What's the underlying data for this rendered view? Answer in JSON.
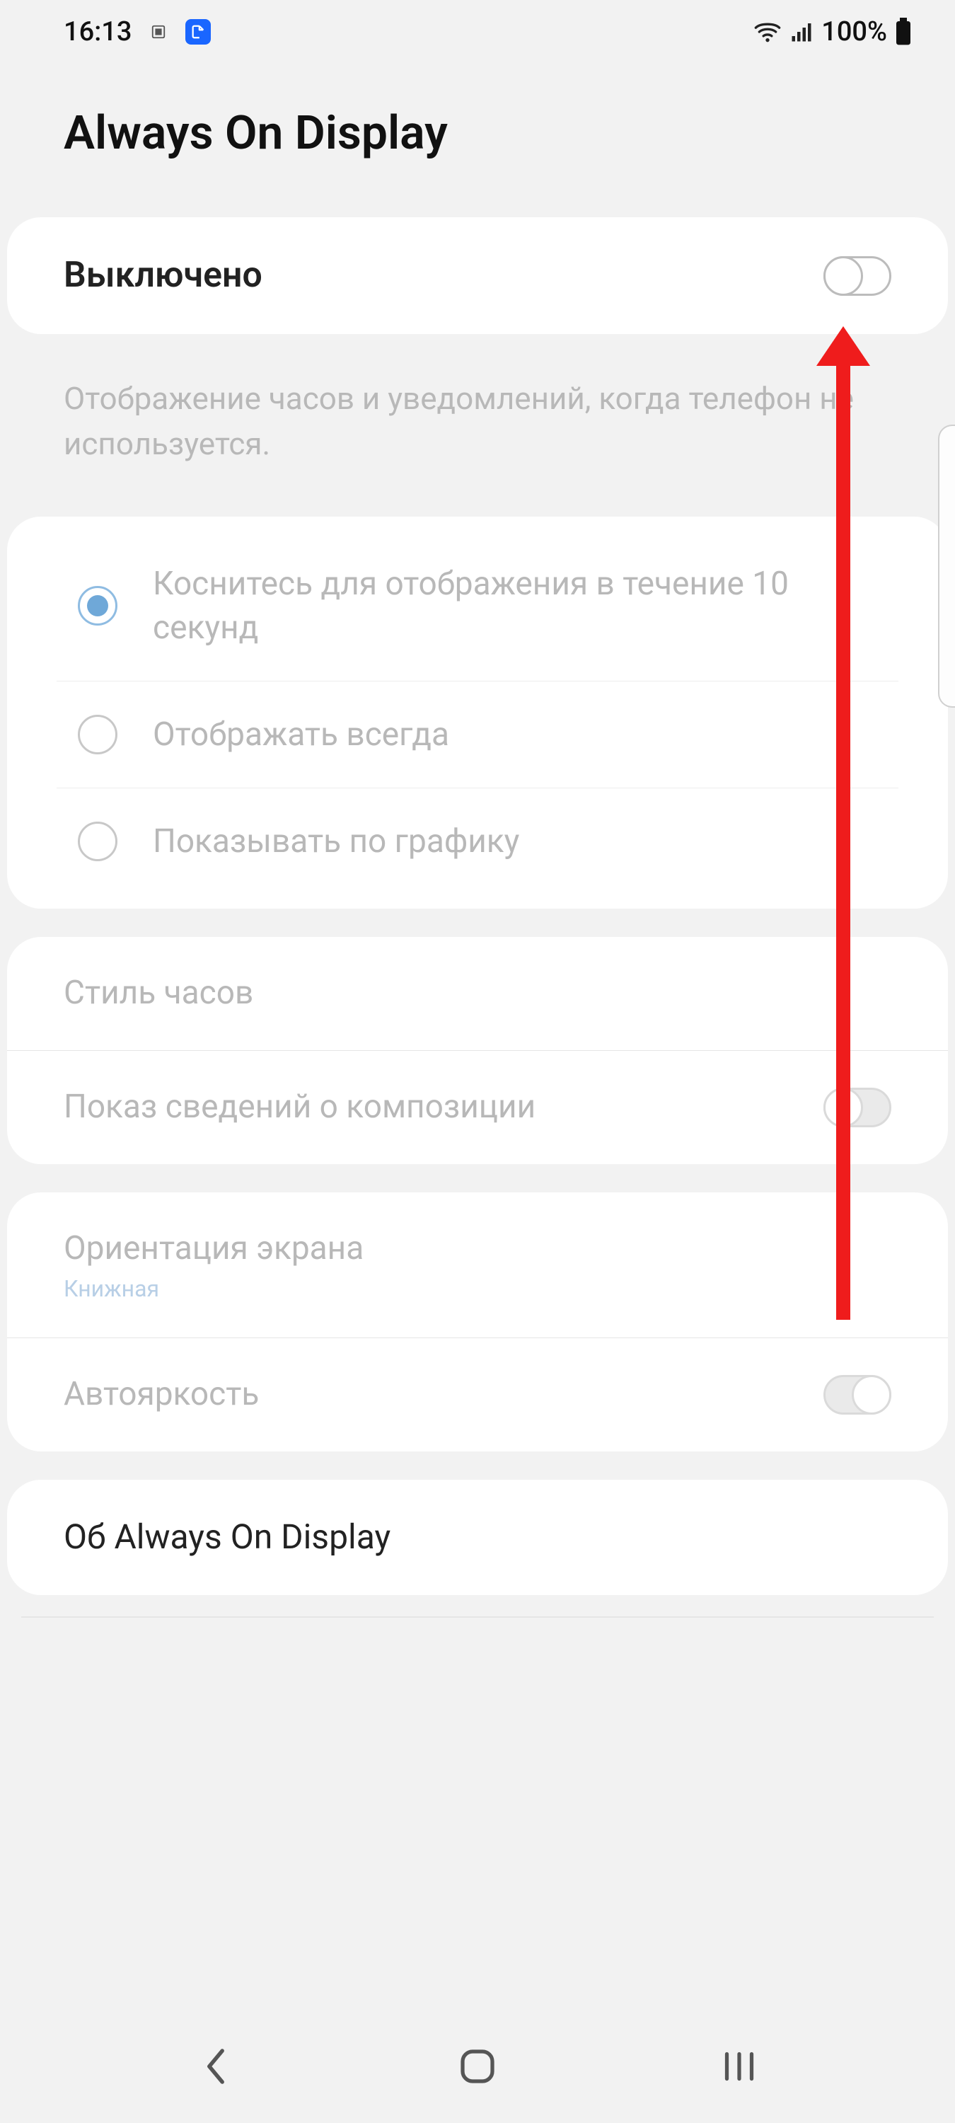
{
  "status": {
    "time": "16:13",
    "battery_text": "100%"
  },
  "header": {
    "title": "Always On Display"
  },
  "master_toggle": {
    "label": "Выключено",
    "on": false
  },
  "description": "Отображение часов и уведомлений, когда телефон не используется.",
  "display_mode": {
    "options": [
      {
        "label": "Коснитесь для отображения в течение 10 секунд",
        "selected": true
      },
      {
        "label": "Отображать всегда",
        "selected": false
      },
      {
        "label": "Показывать по графику",
        "selected": false
      }
    ]
  },
  "settings_group1": {
    "clock_style": "Стиль часов",
    "music_info": {
      "label": "Показ сведений о композиции",
      "on": false
    }
  },
  "settings_group2": {
    "orientation": {
      "label": "Ориентация экрана",
      "value": "Книжная"
    },
    "auto_brightness": {
      "label": "Автояркость",
      "on": false
    }
  },
  "about": {
    "label": "Об Always On Display"
  }
}
